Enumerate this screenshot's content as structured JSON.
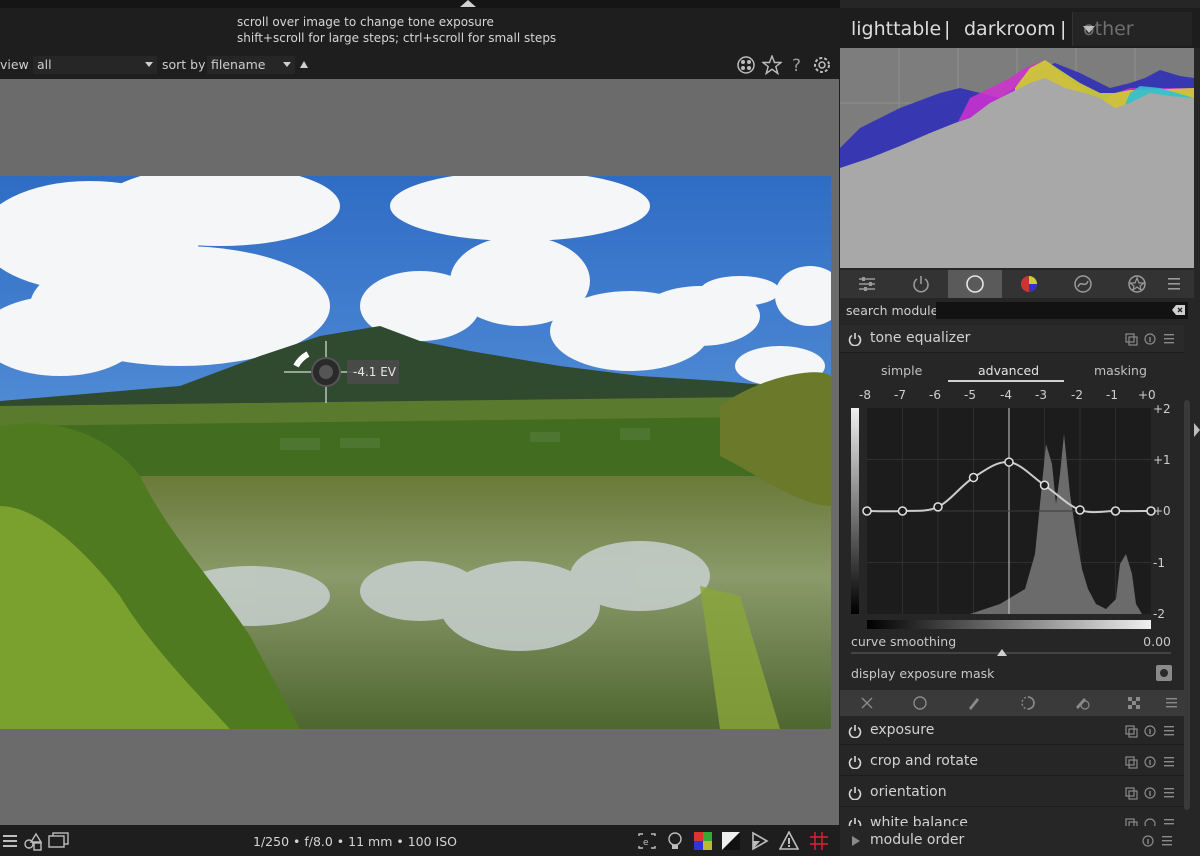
{
  "hint": {
    "line1": "scroll over image to change tone exposure",
    "line2": "shift+scroll for large steps; ctrl+scroll for small steps"
  },
  "filter_bar": {
    "view_label": "view",
    "view_value": "all",
    "sort_label": "sort by",
    "sort_value": "filename",
    "icons": [
      "color-labels-icon",
      "star-icon",
      "help-icon",
      "gear-icon"
    ]
  },
  "cursor_overlay": {
    "ev_readout": "-4.1 EV"
  },
  "bottom_bar": {
    "exif": "1/250 • f/8.0 • 11 mm • 100 ISO",
    "right_icons": [
      "focus-peaking-icon",
      "bulb-icon",
      "color-assessment-icon",
      "overexposed-icon",
      "softproof-icon",
      "gamut-check-icon",
      "guides-icon"
    ],
    "left_icons": [
      "menu-icon",
      "shapes-icon",
      "display-icon"
    ]
  },
  "view_switch": {
    "lighttable": "lighttable",
    "separator": "|",
    "darkroom": "darkroom",
    "other": "other"
  },
  "module_tabs": [
    "quick-access-icon",
    "active-modules-icon",
    "base-modules-icon",
    "color-modules-icon",
    "correct-modules-icon",
    "effect-modules-icon",
    "menu-icon"
  ],
  "search": {
    "label": "search module",
    "value": ""
  },
  "tone_equalizer": {
    "name": "tone equalizer",
    "tabs": [
      "simple",
      "advanced",
      "masking"
    ],
    "active_tab": "advanced",
    "ev_top": [
      "-8",
      "-7",
      "-6",
      "-5",
      "-4",
      "-3",
      "-2",
      "-1",
      "+0"
    ],
    "ev_right": [
      "+2",
      "+1",
      "+0",
      "-1",
      "-2"
    ],
    "curve_points": [
      0.0,
      0.0,
      0.08,
      0.65,
      0.95,
      0.5,
      0.02,
      0.0,
      0.0
    ],
    "curve_smoothing_label": "curve smoothing",
    "curve_smoothing_value": "0.00",
    "display_exposure_mask": "display exposure mask"
  },
  "modules": [
    {
      "name": "exposure"
    },
    {
      "name": "crop and rotate"
    },
    {
      "name": "orientation"
    },
    {
      "name": "white balance"
    }
  ],
  "module_order": "module order",
  "colors": {
    "accent_active_tab": "#5a5a5a",
    "panel_bg": "#262626",
    "center_bg": "#6b6b6b"
  }
}
